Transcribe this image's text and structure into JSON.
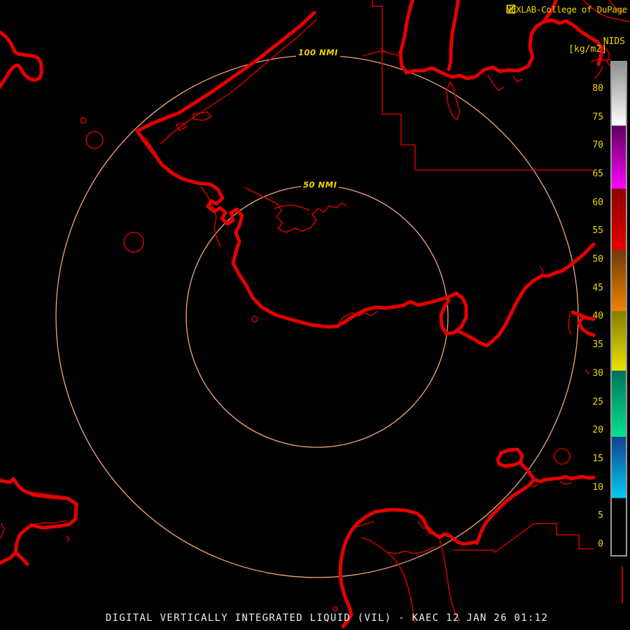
{
  "header": {
    "brand": "NEXLAB-College of DuPage",
    "logo_icon": "college-of-dupage-window-icon"
  },
  "colorbar": {
    "title": "NIDS",
    "units": "[kg/m2]",
    "tick_values": [
      80,
      75,
      70,
      65,
      60,
      55,
      50,
      45,
      40,
      35,
      30,
      25,
      20,
      15,
      10,
      5,
      0
    ],
    "value_range": [
      0,
      85
    ],
    "segments": [
      {
        "from": 85.0,
        "to": 73.7,
        "top_color": "#8e8e8e",
        "bottom_color": "#ffffff"
      },
      {
        "from": 73.7,
        "to": 62.6,
        "top_color": "#5c005c",
        "bottom_color": "#ff00ff"
      },
      {
        "from": 62.6,
        "to": 51.7,
        "top_color": "#8b0000",
        "bottom_color": "#e80000"
      },
      {
        "from": 51.7,
        "to": 41.0,
        "top_color": "#6e3c08",
        "bottom_color": "#f08200"
      },
      {
        "from": 41.0,
        "to": 30.5,
        "top_color": "#857c00",
        "bottom_color": "#eae200"
      },
      {
        "from": 30.5,
        "to": 18.8,
        "top_color": "#00705a",
        "bottom_color": "#00e690"
      },
      {
        "from": 18.8,
        "to": 8.0,
        "top_color": "#14408c",
        "bottom_color": "#00ccf4"
      },
      {
        "from": 8.0,
        "to": -2.1,
        "top_color": "#000000",
        "bottom_color": "#000000"
      }
    ]
  },
  "rings": {
    "outer_label": "100 NMI",
    "inner_label": "50 NMI"
  },
  "caption": "DIGITAL VERTICALLY INTEGRATED LIQUID (VIL) - KAEC 12 JAN 26 01:12",
  "colors": {
    "background": "#000000",
    "coast_thick": "#e60000",
    "coast_thin": "#c80000",
    "ring": "#f4a582",
    "label_yellow": "#f0d500",
    "caption_white": "#eeeeee",
    "bar_border": "#999999"
  }
}
